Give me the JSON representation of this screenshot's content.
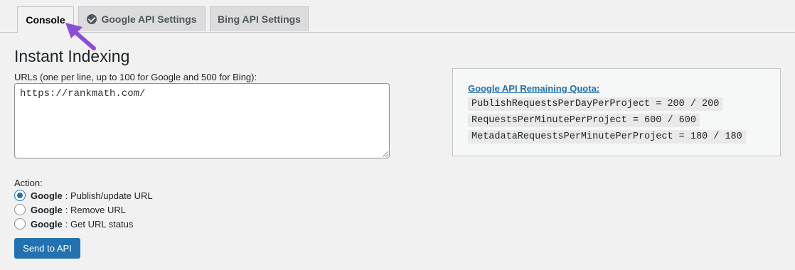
{
  "tabs": {
    "console": "Console",
    "google_api": "Google API Settings",
    "bing_api": "Bing API Settings"
  },
  "page": {
    "title": "Instant Indexing",
    "urls_label": "URLs (one per line, up to 100 for Google and 500 for Bing):",
    "urls_value": "https://rankmath.com/"
  },
  "quota": {
    "title": "Google API Remaining Quota:",
    "lines": [
      "PublishRequestsPerDayPerProject = 200 / 200",
      "RequestsPerMinutePerProject = 600 / 600",
      "MetadataRequestsPerMinutePerProject = 180 / 180"
    ]
  },
  "action": {
    "label": "Action:",
    "options": [
      {
        "engine": "Google",
        "text": ": Publish/update URL",
        "selected": true
      },
      {
        "engine": "Google",
        "text": ": Remove URL",
        "selected": false
      },
      {
        "engine": "Google",
        "text": ": Get URL status",
        "selected": false
      }
    ]
  },
  "submit_label": "Send to API",
  "colors": {
    "accent": "#2271b1",
    "arrow": "#8a4fd8",
    "background": "#f1f1f1"
  },
  "icons": {
    "google_tab": "check-circle-icon",
    "annotation": "arrow-icon"
  }
}
